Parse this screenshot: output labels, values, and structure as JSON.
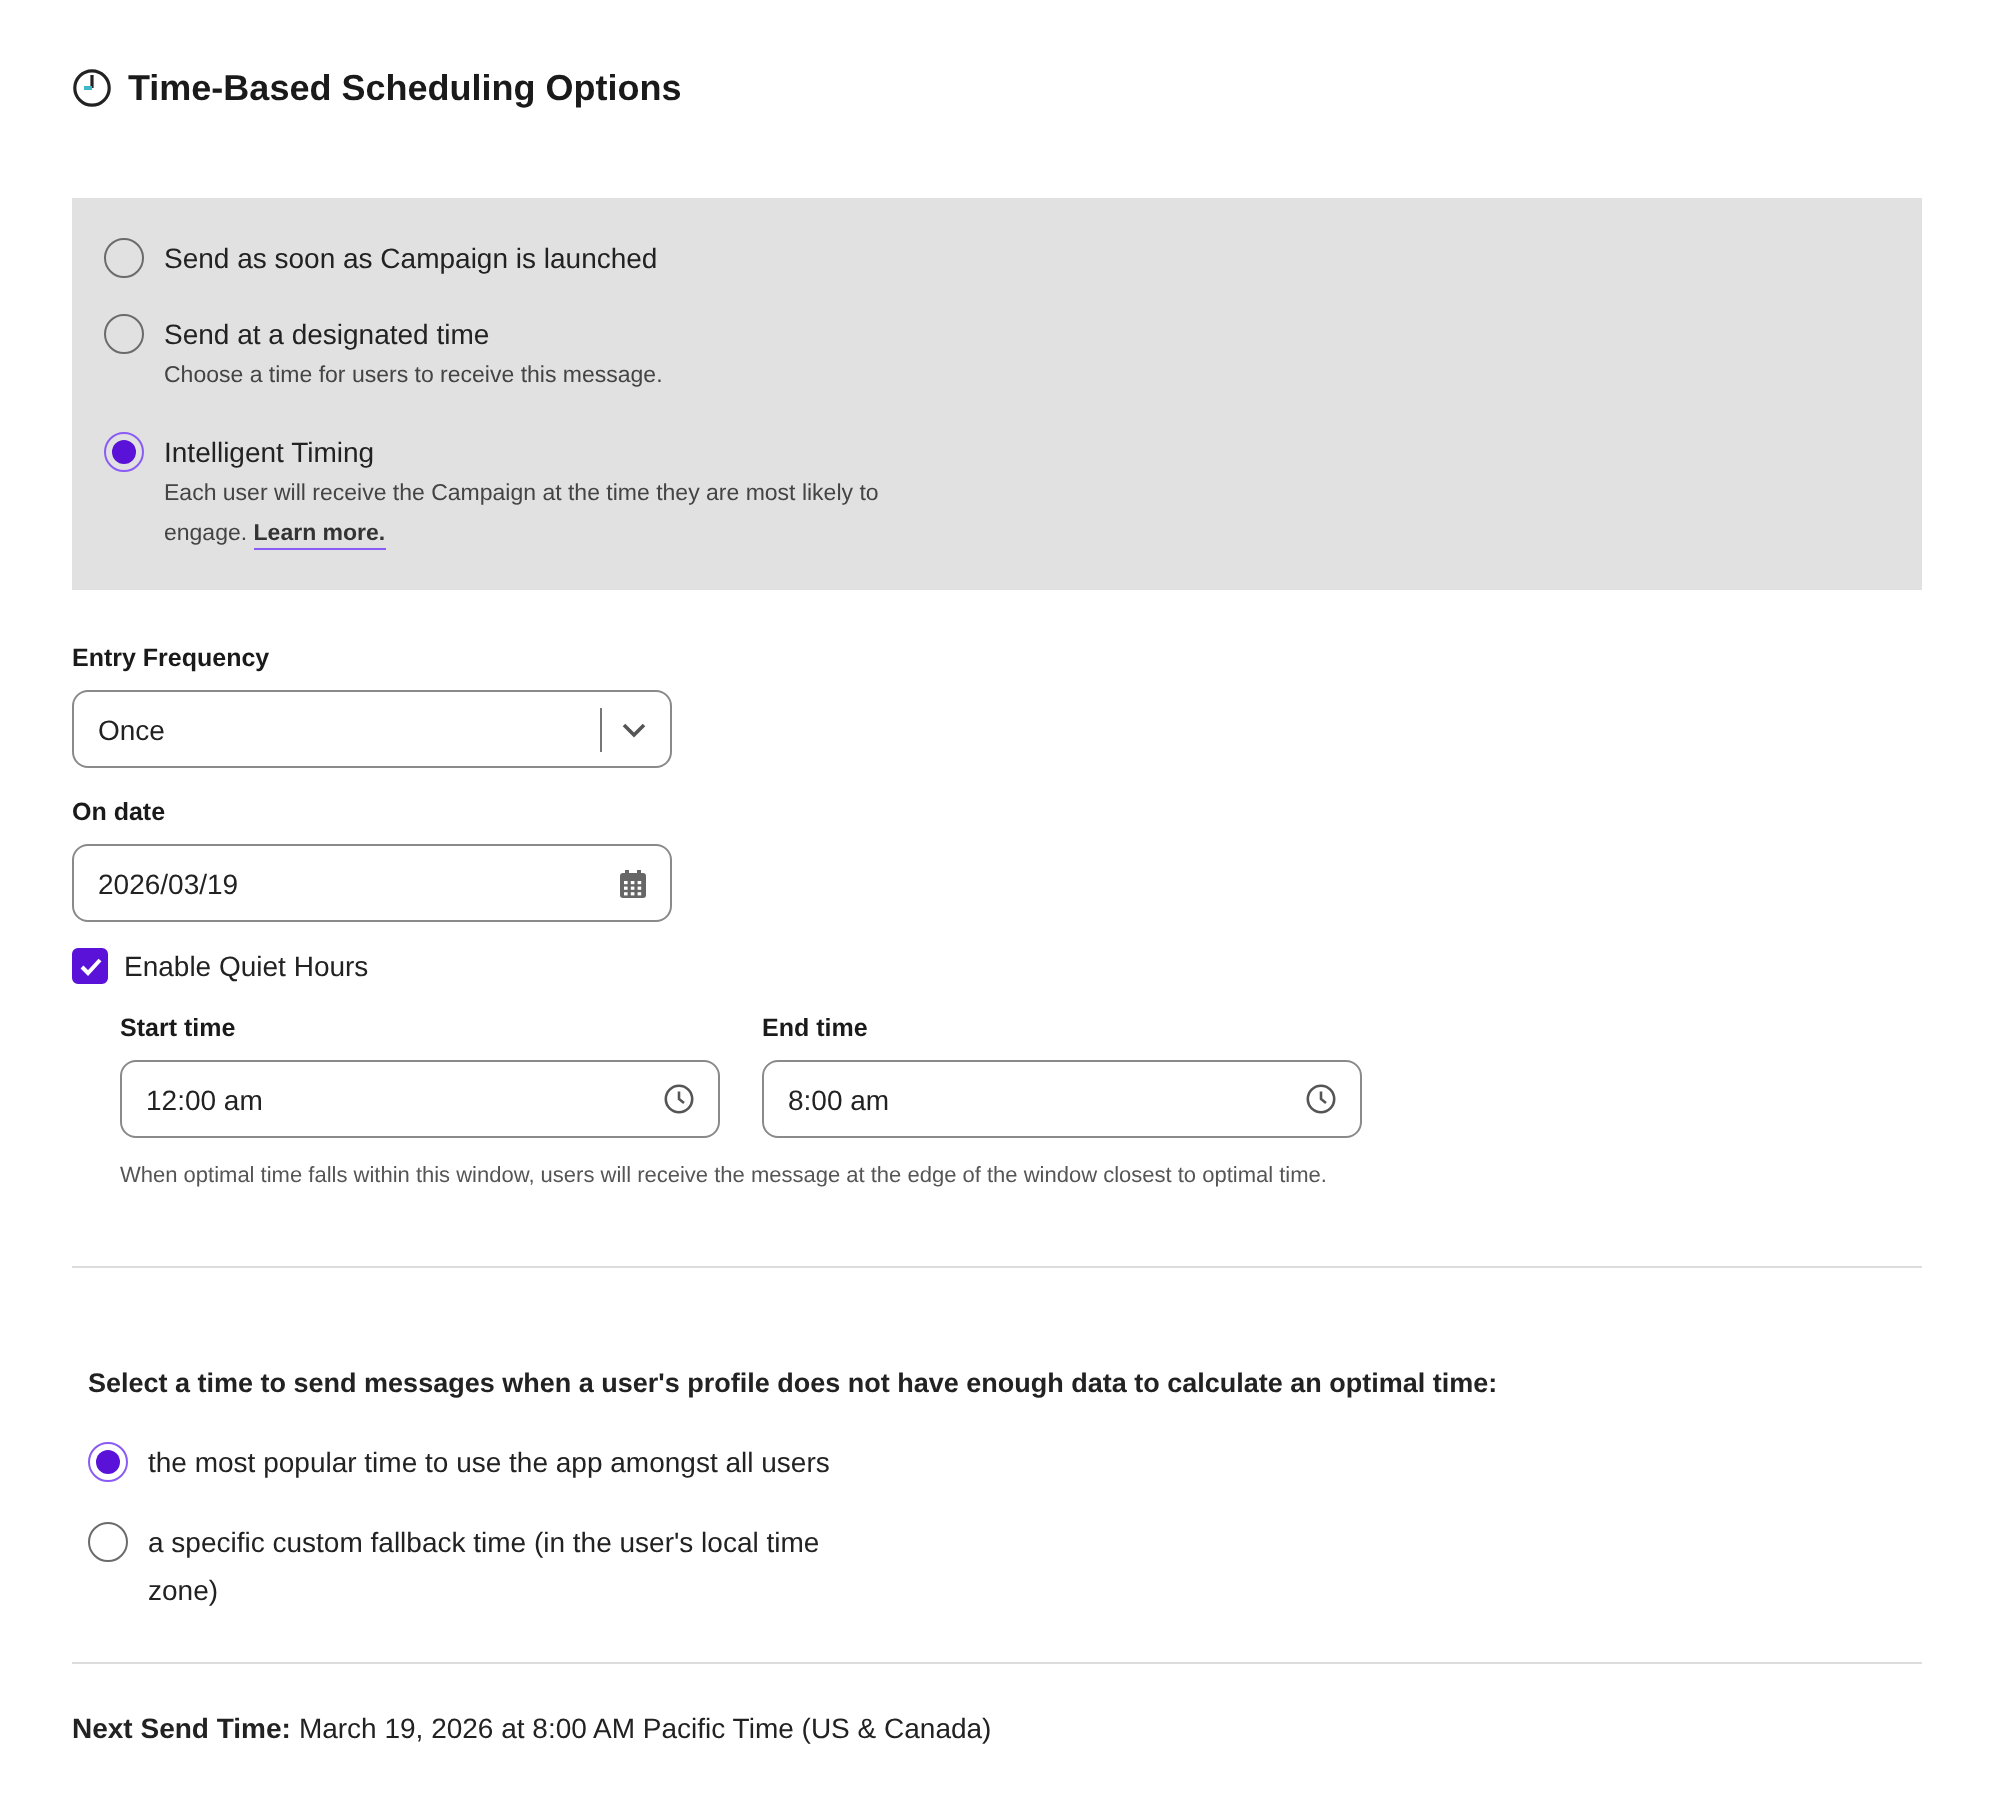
{
  "header": {
    "title": "Time-Based Scheduling Options"
  },
  "delivery_options": [
    {
      "label": "Send as soon as Campaign is launched",
      "selected": false
    },
    {
      "label": "Send at a designated time",
      "description": "Choose a time for users to receive this message.",
      "selected": false
    },
    {
      "label": "Intelligent Timing",
      "description": "Each user will receive the Campaign at the time they are most likely to engage.",
      "link": "Learn more.",
      "selected": true
    }
  ],
  "entry_frequency": {
    "label": "Entry Frequency",
    "value": "Once"
  },
  "on_date": {
    "label": "On date",
    "value": "2026/03/19"
  },
  "quiet_hours": {
    "label": "Enable Quiet Hours",
    "checked": true,
    "start": {
      "label": "Start time",
      "value": "12:00 am"
    },
    "end": {
      "label": "End time",
      "value": "8:00 am"
    },
    "help": "When optimal time falls within this window, users will receive the message at the edge of the window closest to optimal time."
  },
  "fallback": {
    "heading": "Select a time to send messages when a user's profile does not have enough data to calculate an optimal time:",
    "options": [
      {
        "label": "the most popular time to use the app amongst all users",
        "selected": true
      },
      {
        "label": "a specific custom fallback time (in the user's local time zone)",
        "selected": false
      }
    ]
  },
  "next_send": {
    "label": "Next Send Time:",
    "value": "March 19, 2026 at 8:00 AM Pacific Time (US & Canada)"
  }
}
